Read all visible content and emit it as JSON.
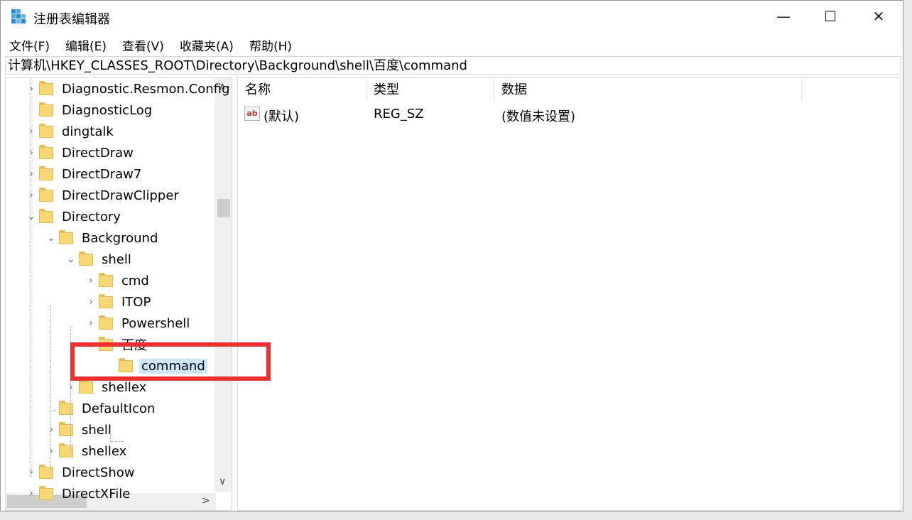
{
  "window": {
    "title": "注册表编辑器",
    "minimize": "—",
    "maximize": "☐",
    "close": "✕"
  },
  "menu": [
    "文件(F)",
    "编辑(E)",
    "查看(V)",
    "收藏夹(A)",
    "帮助(H)"
  ],
  "address": "计算机\\HKEY_CLASSES_ROOT\\Directory\\Background\\shell\\百度\\command",
  "tree": [
    {
      "label": "Diagnostic.Resmon.Config",
      "level": 0,
      "expander": "collapsed"
    },
    {
      "label": "DiagnosticLog",
      "level": 0,
      "expander": "none"
    },
    {
      "label": "dingtalk",
      "level": 0,
      "expander": "collapsed"
    },
    {
      "label": "DirectDraw",
      "level": 0,
      "expander": "collapsed"
    },
    {
      "label": "DirectDraw7",
      "level": 0,
      "expander": "collapsed"
    },
    {
      "label": "DirectDrawClipper",
      "level": 0,
      "expander": "collapsed"
    },
    {
      "label": "Directory",
      "level": 0,
      "expander": "expanded"
    },
    {
      "label": "Background",
      "level": 1,
      "expander": "expanded"
    },
    {
      "label": "shell",
      "level": 2,
      "expander": "expanded"
    },
    {
      "label": "cmd",
      "level": 3,
      "expander": "collapsed"
    },
    {
      "label": "ITOP",
      "level": 3,
      "expander": "collapsed"
    },
    {
      "label": "Powershell",
      "level": 3,
      "expander": "collapsed"
    },
    {
      "label": "百度",
      "level": 3,
      "expander": "expanded"
    },
    {
      "label": "command",
      "level": 4,
      "expander": "none",
      "selected": true
    },
    {
      "label": "shellex",
      "level": 2,
      "expander": "collapsed"
    },
    {
      "label": "DefaultIcon",
      "level": 1,
      "expander": "none"
    },
    {
      "label": "shell",
      "level": 1,
      "expander": "collapsed"
    },
    {
      "label": "shellex",
      "level": 1,
      "expander": "collapsed"
    },
    {
      "label": "DirectShow",
      "level": 0,
      "expander": "collapsed"
    },
    {
      "label": "DirectXFile",
      "level": 0,
      "expander": "collapsed"
    }
  ],
  "columns": {
    "name": "名称",
    "type": "类型",
    "data": "数据"
  },
  "values": [
    {
      "icon": "ab",
      "name": "(默认)",
      "type": "REG_SZ",
      "data": "(数值未设置)"
    }
  ],
  "colors": {
    "highlight": "#f22d2d",
    "selection": "#cce8ff",
    "folder": "#f8d775"
  }
}
